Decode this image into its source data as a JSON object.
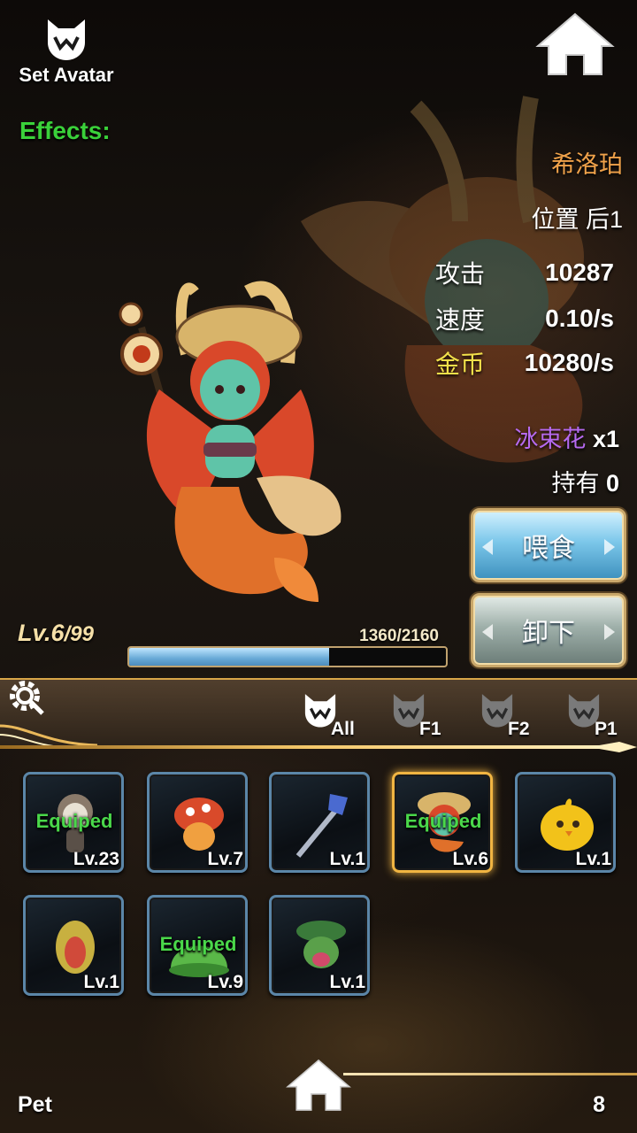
{
  "header": {
    "avatar_label": "Set Avatar",
    "avatar_icon": "wolf-head-icon",
    "home_icon": "home-icon"
  },
  "effects_label": "Effects:",
  "pet": {
    "name": "希洛珀",
    "position": "位置 后1",
    "stats": [
      {
        "label": "攻击",
        "value": "10287",
        "label_color": "#ffffff"
      },
      {
        "label": "速度",
        "value": "0.10/s",
        "label_color": "#ffffff"
      },
      {
        "label": "金币",
        "value": "10280/s",
        "label_color": "#f2e04a"
      }
    ],
    "item_name": "冰束花",
    "item_count": "x1",
    "own_label": "持有",
    "own_count": "0",
    "level": "Lv.6",
    "level_max": "/99",
    "exp_text": "1360/2160",
    "exp_fraction": 0.63
  },
  "buttons": {
    "feed": "喂食",
    "unequip": "卸下"
  },
  "filters": [
    {
      "label": "All",
      "active": true
    },
    {
      "label": "F1",
      "active": false
    },
    {
      "label": "F2",
      "active": false
    },
    {
      "label": "P1",
      "active": false
    }
  ],
  "pets": [
    {
      "level": "Lv.23",
      "equipped": "Equiped",
      "icon": "skeleton-pet-icon",
      "color": "#8a7a6a"
    },
    {
      "level": "Lv.7",
      "equipped": "",
      "icon": "mushroom-pet-icon",
      "color": "#d94a2a"
    },
    {
      "level": "Lv.1",
      "equipped": "",
      "icon": "spear-pet-icon",
      "color": "#4a6ad0"
    },
    {
      "level": "Lv.6",
      "equipped": "Equiped",
      "icon": "mermaid-pet-icon",
      "color": "#4ab89a",
      "selected": true
    },
    {
      "level": "Lv.1",
      "equipped": "",
      "icon": "chick-pet-icon",
      "color": "#f2c21a"
    },
    {
      "level": "Lv.1",
      "equipped": "",
      "icon": "pod-pet-icon",
      "color": "#c8b040"
    },
    {
      "level": "Lv.9",
      "equipped": "Equiped",
      "icon": "slime-pet-icon",
      "color": "#5ab848"
    },
    {
      "level": "Lv.1",
      "equipped": "",
      "icon": "leaf-bug-pet-icon",
      "color": "#5aa04a"
    }
  ],
  "footer": {
    "tab_label": "Pet",
    "count": "8"
  }
}
